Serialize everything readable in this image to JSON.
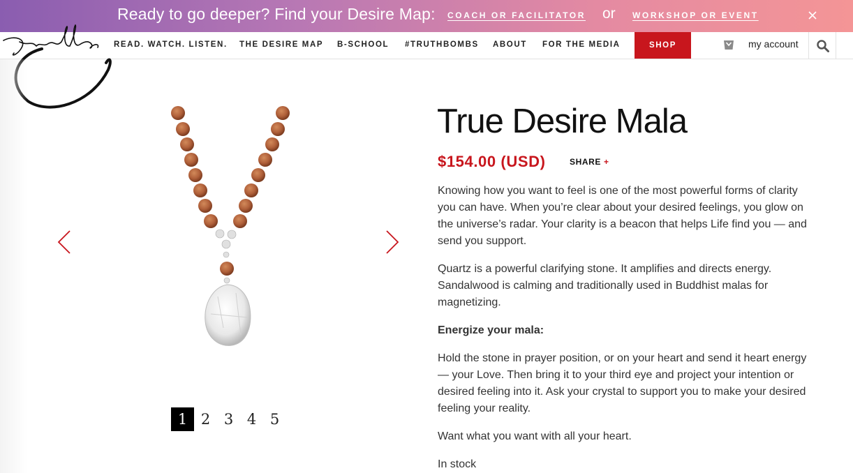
{
  "promo": {
    "text": "Ready to go deeper? Find your Desire Map:",
    "link_coach": "COACH OR FACILITATOR",
    "or": "or",
    "link_workshop": "WORKSHOP OR EVENT"
  },
  "nav": {
    "items": [
      "READ. WATCH. LISTEN.",
      "THE DESIRE MAP",
      "B-SCHOOL",
      "#TRUTHBOMBS",
      "ABOUT",
      "FOR THE MEDIA"
    ],
    "shop": "SHOP",
    "account": "my account"
  },
  "product": {
    "title": "True Desire Mala",
    "price": "$154.00 (USD)",
    "share": "SHARE",
    "share_plus": "+",
    "paragraphs": [
      "Knowing how you want to feel is one of the most powerful forms of clarity you can have. When you’re clear about your desired feelings, you glow on the universe’s radar. Your clarity is a beacon that helps Life find you — and send you support.",
      "Quartz is a powerful clarifying stone. It amplifies and directs energy. Sandalwood is calming and traditionally used in Buddhist malas for magnetizing.",
      "Energize your mala:",
      "Hold the stone in prayer position, or on your heart and send it heart energy — your Love. Then bring it to your third eye and project your intention or desired feeling into it. Ask your crystal to support you to make your desired feeling your reality.",
      "Want what you want with all your heart.",
      "In stock"
    ]
  },
  "gallery": {
    "pages": [
      "1",
      "2",
      "3",
      "4",
      "5"
    ],
    "active_page": "1"
  },
  "colors": {
    "accent_red": "#c8161d",
    "promo_gradient_start": "#8a5db0",
    "promo_gradient_end": "#f49596"
  }
}
